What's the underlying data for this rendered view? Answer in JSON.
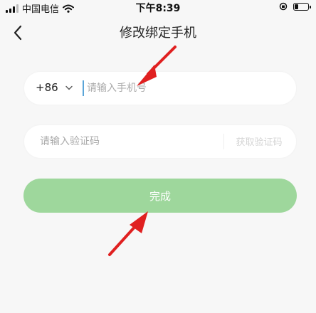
{
  "status_bar": {
    "carrier": "中国电信",
    "time": "下午8:39",
    "battery_level": 0.3
  },
  "nav": {
    "title": "修改绑定手机",
    "back_icon": "chevron-left-icon"
  },
  "phone": {
    "country_code": "+86",
    "placeholder": "请输入手机号"
  },
  "code": {
    "placeholder": "请输入验证码",
    "get_code_label": "获取验证码"
  },
  "submit": {
    "label": "完成",
    "color": "#9ed79c"
  },
  "annotation_color": "#e02020"
}
